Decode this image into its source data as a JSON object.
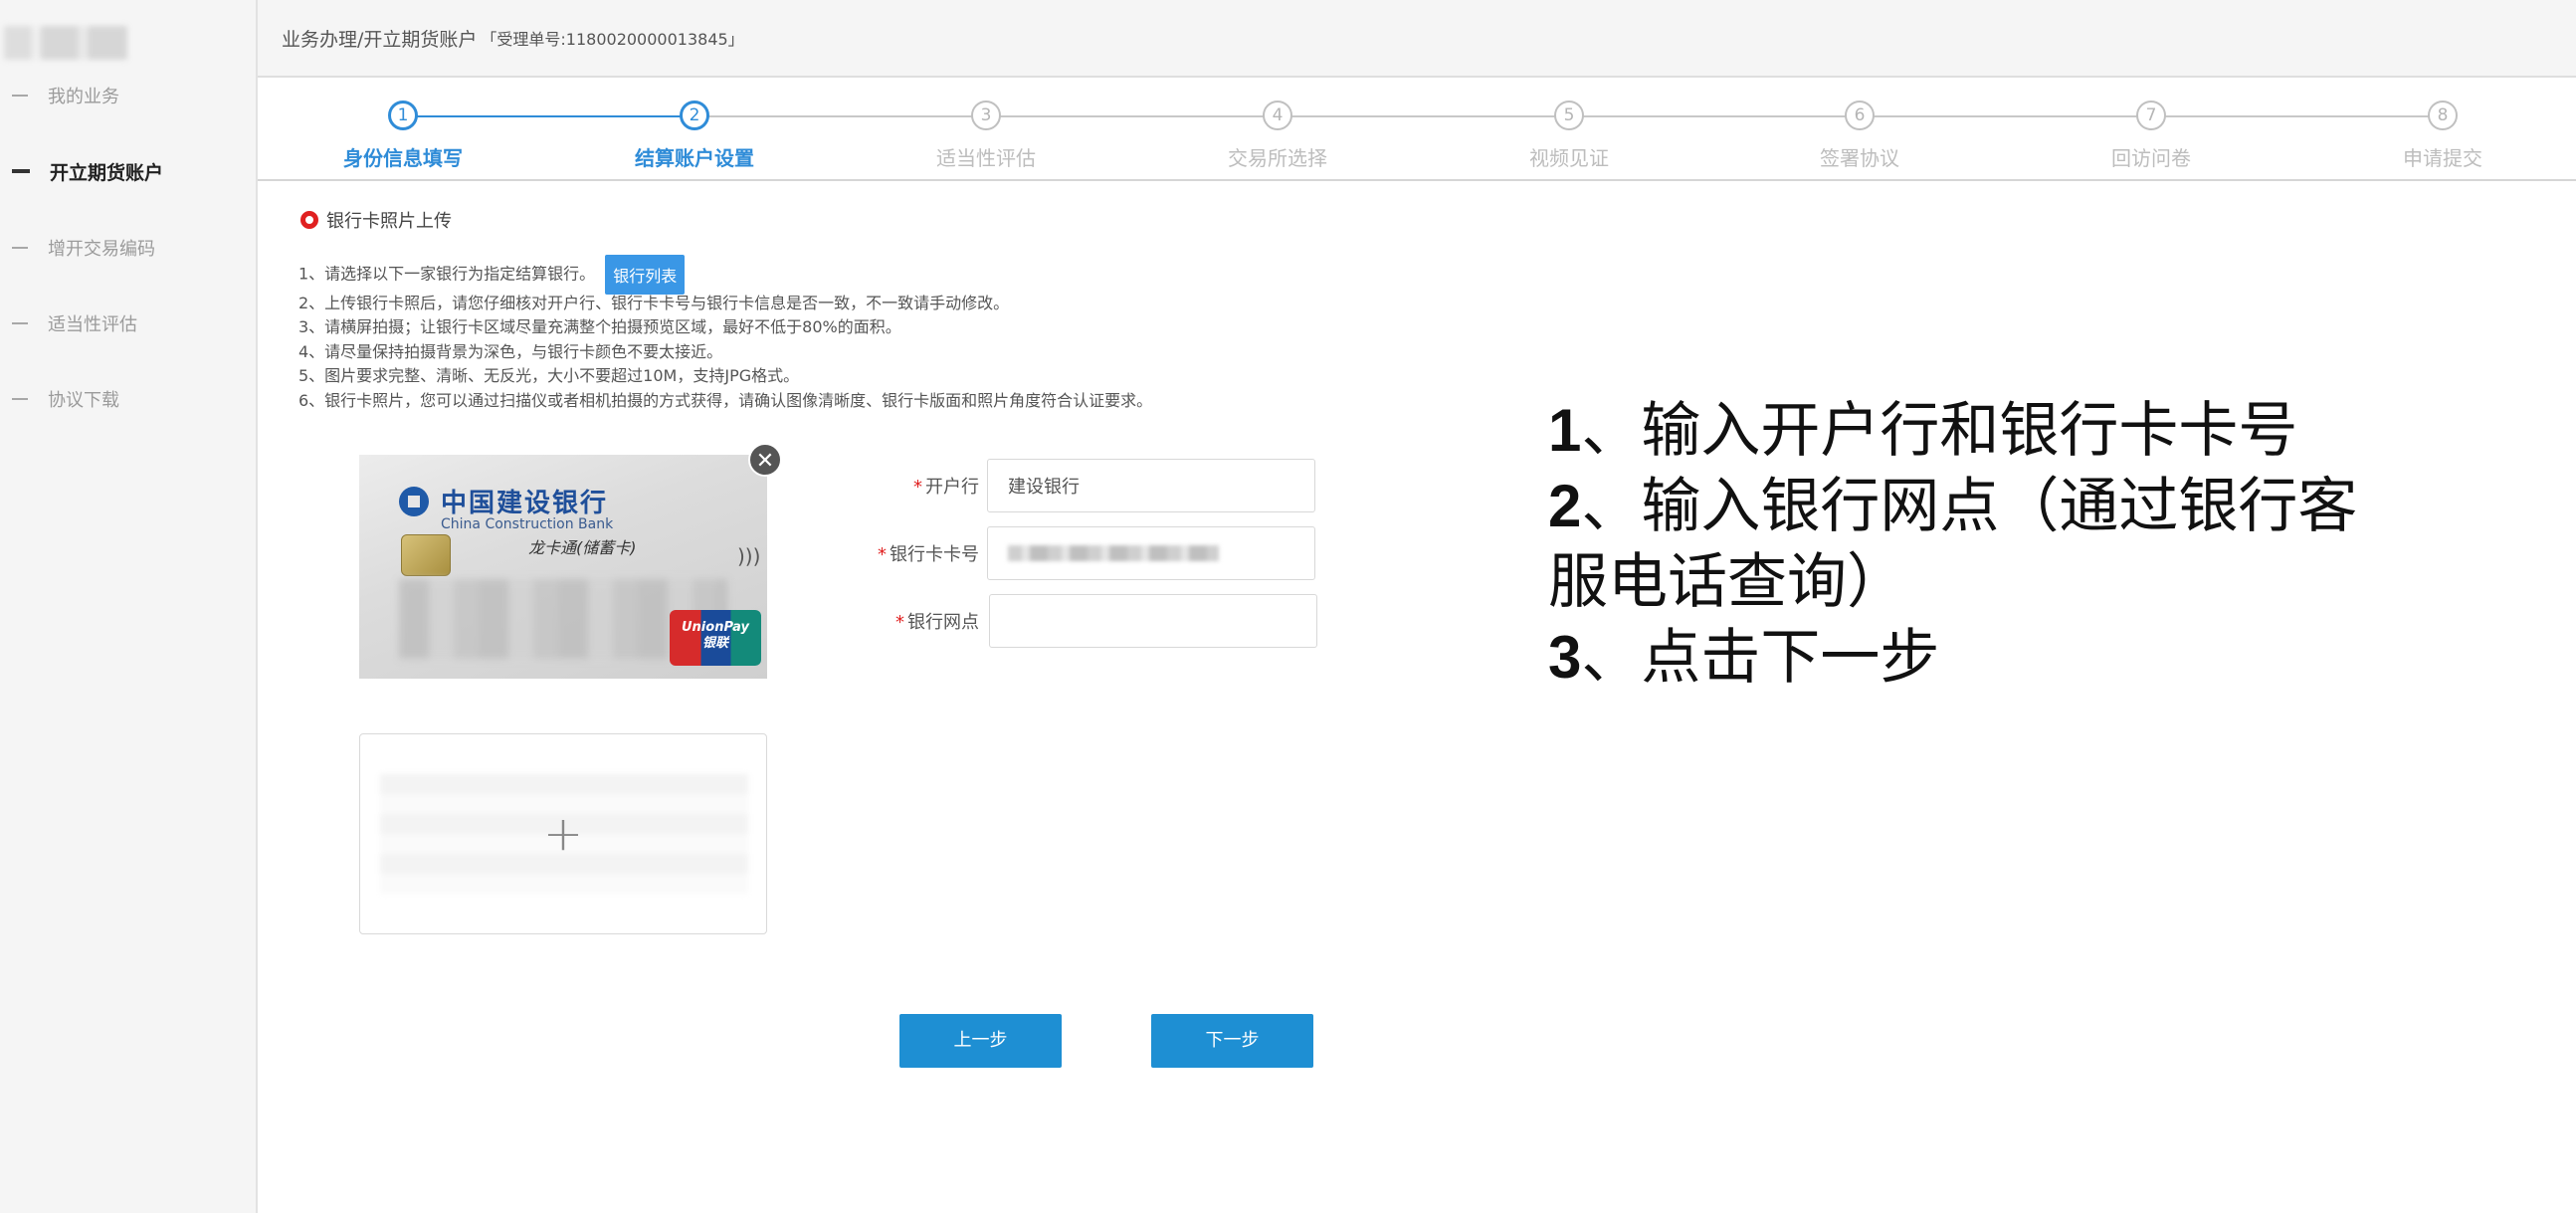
{
  "sidebar": {
    "items": [
      {
        "label": "我的业务"
      },
      {
        "label": "开立期货账户"
      },
      {
        "label": "增开交易编码"
      },
      {
        "label": "适当性评估"
      },
      {
        "label": "协议下载"
      }
    ]
  },
  "header": {
    "breadcrumb": "业务办理/开立期货账户",
    "ticket": "「受理单号:1180020000013845」"
  },
  "steps": [
    {
      "num": "1",
      "label": "身份信息填写"
    },
    {
      "num": "2",
      "label": "结算账户设置"
    },
    {
      "num": "3",
      "label": "适当性评估"
    },
    {
      "num": "4",
      "label": "交易所选择"
    },
    {
      "num": "5",
      "label": "视频见证"
    },
    {
      "num": "6",
      "label": "签署协议"
    },
    {
      "num": "7",
      "label": "回访问卷"
    },
    {
      "num": "8",
      "label": "申请提交"
    }
  ],
  "content": {
    "section_title": "银行卡照片上传",
    "instructions": [
      "1、请选择以下一家银行为指定结算银行。",
      "2、上传银行卡照后，请您仔细核对开户行、银行卡卡号与银行卡信息是否一致，不一致请手动修改。",
      "3、请横屏拍摄；让银行卡区域尽量充满整个拍摄预览区域，最好不低于80%的面积。",
      "4、请尽量保持拍摄背景为深色，与银行卡颜色不要太接近。",
      "5、图片要求完整、清晰、无反光，大小不要超过10M，支持JPG格式。",
      "6、银行卡照片，您可以通过扫描仪或者相机拍摄的方式获得，请确认图像清晰度、银行卡版面和照片角度符合认证要求。"
    ],
    "bank_list_button": "银行列表",
    "card": {
      "bank_cn": "中国建设银行",
      "bank_en": "China Construction Bank",
      "card_type": "龙卡通(储蓄卡)",
      "network": "UnionPay",
      "network_cn": "银联",
      "close_glyph": "✕"
    },
    "upload_plus": "+"
  },
  "form": {
    "required_mark": "*",
    "bank_label": "开户行",
    "bank_value": "建设银行",
    "card_no_label": "银行卡卡号",
    "branch_label": "银行网点",
    "branch_value": ""
  },
  "buttons": {
    "prev": "上一步",
    "next": "下一步"
  },
  "annotation": {
    "lines": [
      {
        "num": "1",
        "text": "、输入开户行和银行卡卡号"
      },
      {
        "num": "2",
        "text": "、输入银行网点（通过银行客"
      },
      {
        "num": "",
        "text": "服电话查询）"
      },
      {
        "num": "3",
        "text": "、点击下一步"
      }
    ]
  },
  "colors": {
    "accent": "#2f8cd8",
    "button": "#1e8fd3",
    "required": "#e02020"
  }
}
